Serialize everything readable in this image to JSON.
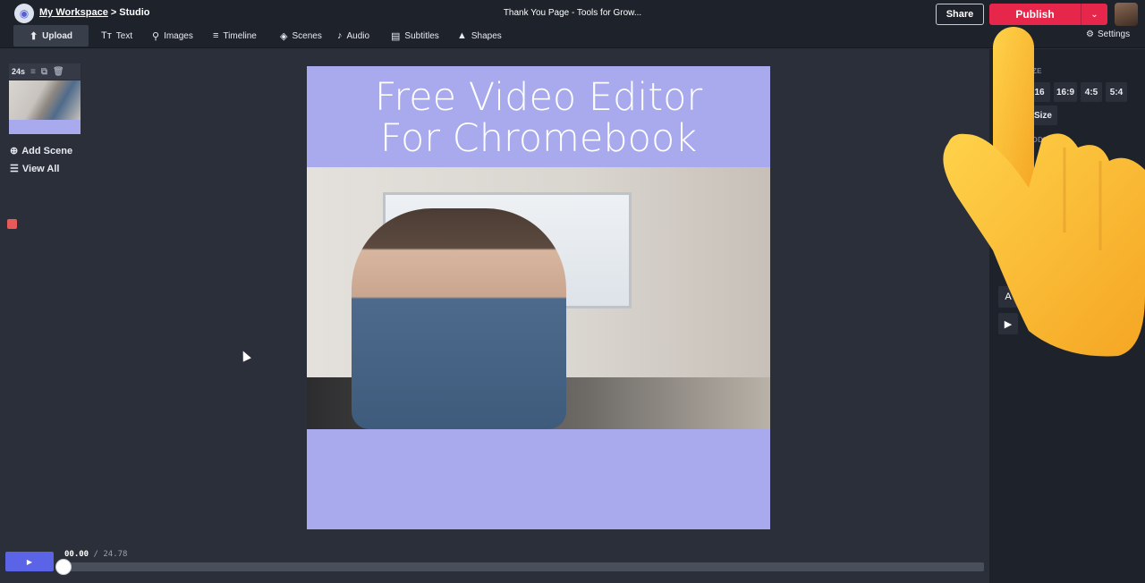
{
  "header": {
    "workspace_link": "My Workspace",
    "separator": ">",
    "section": "Studio",
    "document_title": "Thank You Page - Tools for Grow...",
    "share_label": "Share",
    "publish_label": "Publish"
  },
  "toolbar": {
    "upload": "Upload",
    "text": "Text",
    "images": "Images",
    "timeline": "Timeline",
    "scenes": "Scenes",
    "audio": "Audio",
    "subtitles": "Subtitles",
    "shapes": "Shapes",
    "settings": "Settings"
  },
  "scenes_panel": {
    "duration": "24s",
    "add_scene": "Add Scene",
    "view_all": "View All"
  },
  "canvas": {
    "headline_line1": "Free Video Editor",
    "headline_line2": "For Chromebook",
    "background_color": "#a9aaee"
  },
  "player": {
    "current_time": "00.00",
    "separator": "/",
    "total_time": "24.78",
    "progress": 0
  },
  "right_panel": {
    "size_label": "ZE",
    "ratios": [
      "16",
      "16:9",
      "4:5",
      "5:4"
    ],
    "size_button": "Size",
    "padding_label": "DDING",
    "text_tool_fragment": "A"
  },
  "colors": {
    "accent": "#5b63e6",
    "publish": "#e6264a",
    "background": "#2b2f3a",
    "chrome": "#1e222b"
  }
}
